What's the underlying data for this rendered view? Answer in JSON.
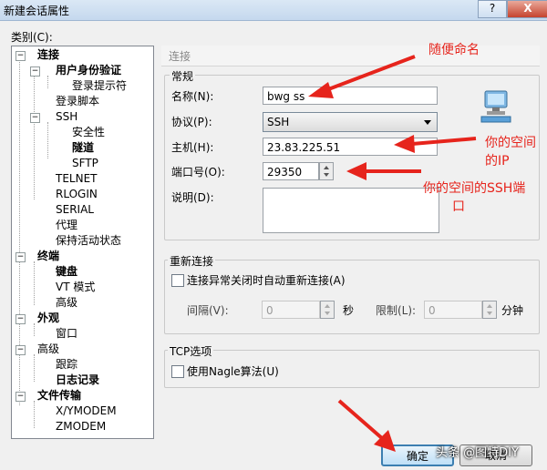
{
  "window": {
    "title": "新建会话属性",
    "help_btn": "?",
    "close_btn": "X"
  },
  "tree": {
    "label": "类别(C):",
    "items": [
      {
        "text": "连接",
        "bold": true
      },
      {
        "text": "用户身份验证",
        "bold": true
      },
      {
        "text": "登录提示符",
        "bold": false
      },
      {
        "text": "登录脚本",
        "bold": false
      },
      {
        "text": "SSH",
        "bold": false
      },
      {
        "text": "安全性",
        "bold": false
      },
      {
        "text": "隧道",
        "bold": true
      },
      {
        "text": "SFTP",
        "bold": false
      },
      {
        "text": "TELNET",
        "bold": false
      },
      {
        "text": "RLOGIN",
        "bold": false
      },
      {
        "text": "SERIAL",
        "bold": false
      },
      {
        "text": "代理",
        "bold": false
      },
      {
        "text": "保持活动状态",
        "bold": false
      },
      {
        "text": "终端",
        "bold": true
      },
      {
        "text": "键盘",
        "bold": true
      },
      {
        "text": "VT 模式",
        "bold": false
      },
      {
        "text": "高级",
        "bold": false
      },
      {
        "text": "外观",
        "bold": true
      },
      {
        "text": "窗口",
        "bold": false
      },
      {
        "text": "高级",
        "bold": false
      },
      {
        "text": "跟踪",
        "bold": false
      },
      {
        "text": "日志记录",
        "bold": true
      },
      {
        "text": "文件传输",
        "bold": true
      },
      {
        "text": "X/YMODEM",
        "bold": false
      },
      {
        "text": "ZMODEM",
        "bold": false
      }
    ]
  },
  "panel": {
    "header": "连接",
    "general": {
      "title": "常规",
      "name_label": "名称(N):",
      "name_value": "bwg ss",
      "protocol_label": "协议(P):",
      "protocol_value": "SSH",
      "host_label": "主机(H):",
      "host_value": "23.83.225.51",
      "port_label": "端口号(O):",
      "port_value": "29350",
      "desc_label": "说明(D):"
    },
    "reconnect": {
      "title": "重新连接",
      "auto_label": "连接异常关闭时自动重新连接(A)",
      "interval_label": "间隔(V):",
      "interval_value": "0",
      "sec_label": "秒",
      "limit_label": "限制(L):",
      "limit_value": "0",
      "min_label": "分钟"
    },
    "tcp": {
      "title": "TCP选项",
      "nagle_label": "使用Nagle算法(U)"
    }
  },
  "buttons": {
    "ok": "确定",
    "cancel": "取消"
  },
  "annotations": {
    "name": "随便命名",
    "ip_line1": "你的空间",
    "ip_line2": "的IP",
    "port_line1": "你的空间的SSH端",
    "port_line2": "口"
  },
  "watermark": "头条 @图特DIY",
  "colors": {
    "annotation": "#e6241c",
    "ok_border": "#3c7fb1"
  }
}
